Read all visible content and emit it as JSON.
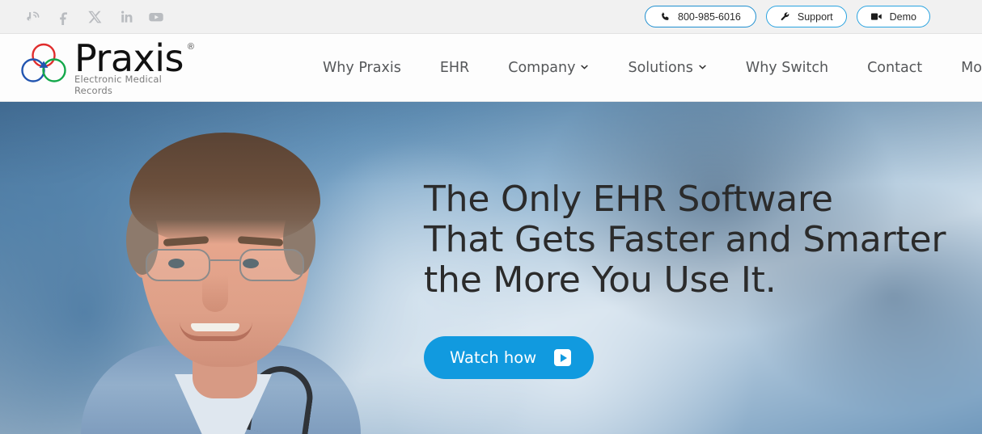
{
  "topbar": {
    "social": [
      {
        "name": "blog-icon",
        "label": "Blog"
      },
      {
        "name": "facebook-icon",
        "label": "Facebook"
      },
      {
        "name": "x-twitter-icon",
        "label": "X"
      },
      {
        "name": "linkedin-icon",
        "label": "LinkedIn"
      },
      {
        "name": "youtube-icon",
        "label": "YouTube"
      }
    ],
    "pills": [
      {
        "name": "phone-pill",
        "icon": "phone-icon",
        "label": "800-985-6016"
      },
      {
        "name": "support-pill",
        "icon": "wrench-icon",
        "label": "Support"
      },
      {
        "name": "demo-pill",
        "icon": "video-camera-icon",
        "label": "Demo"
      }
    ]
  },
  "logo": {
    "word": "Praxis",
    "registered": "®",
    "tagline": "Electronic Medical Records",
    "colors": {
      "red": "#e02c2c",
      "blue": "#2255b0",
      "green": "#14a84a"
    }
  },
  "nav": {
    "items": [
      {
        "label": "Why Praxis",
        "has_dropdown": false
      },
      {
        "label": "EHR",
        "has_dropdown": false
      },
      {
        "label": "Company",
        "has_dropdown": true
      },
      {
        "label": "Solutions",
        "has_dropdown": true
      },
      {
        "label": "Why Switch",
        "has_dropdown": false
      },
      {
        "label": "Contact",
        "has_dropdown": false
      },
      {
        "label": "More",
        "has_dropdown": true
      }
    ]
  },
  "hero": {
    "headline_lines": [
      "The Only EHR Software",
      "That Gets Faster and Smarter",
      "the More You Use It."
    ],
    "cta_label": "Watch how",
    "cta_color": "#119ADF",
    "image_alt": "Smiling male physician with glasses and stethoscope"
  }
}
